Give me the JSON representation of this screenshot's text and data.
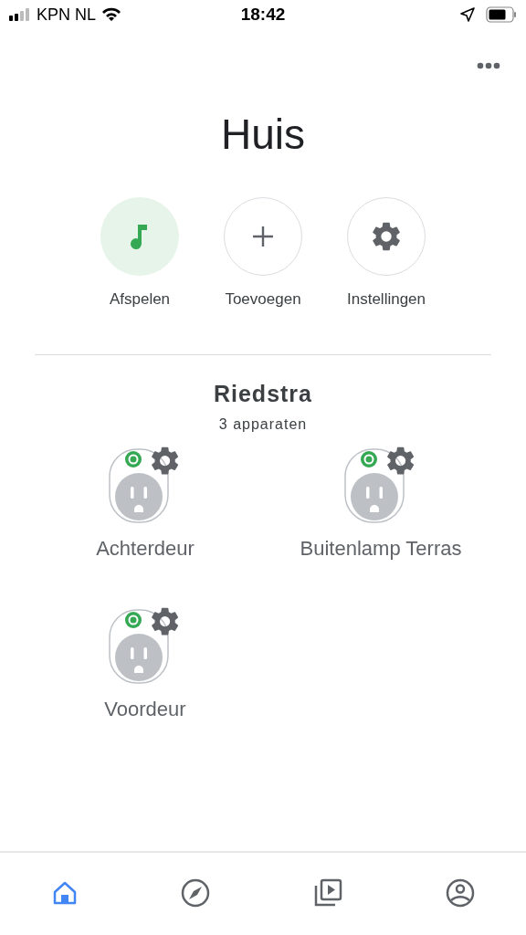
{
  "status_bar": {
    "carrier": "KPN NL",
    "time": "18:42"
  },
  "title": "Huis",
  "actions": [
    {
      "kind": "play",
      "label": "Afspelen"
    },
    {
      "kind": "add",
      "label": "Toevoegen"
    },
    {
      "kind": "settings",
      "label": "Instellingen"
    }
  ],
  "room": {
    "name": "Riedstra",
    "count": "3 apparaten",
    "devices": [
      {
        "name": "Achterdeur",
        "on": true
      },
      {
        "name": "Buitenlamp Terras",
        "on": true
      },
      {
        "name": "Voordeur",
        "on": true
      }
    ]
  },
  "nav": [
    {
      "kind": "home",
      "selected": true
    },
    {
      "kind": "discover",
      "selected": false
    },
    {
      "kind": "media",
      "selected": false
    },
    {
      "kind": "account",
      "selected": false
    }
  ]
}
